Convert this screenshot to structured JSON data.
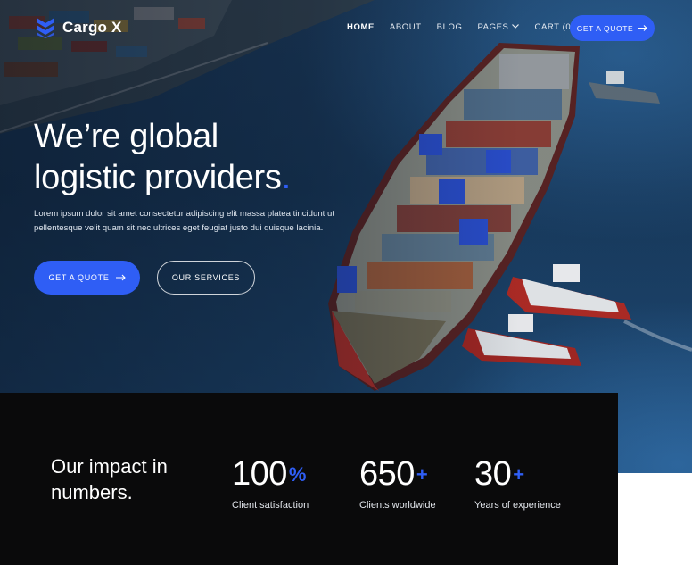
{
  "brand": {
    "name": "Cargo X",
    "logo_icon": "layered-chevron-logo",
    "accent": "#2f5ef5"
  },
  "nav": {
    "items": [
      {
        "label": "HOME",
        "active": true
      },
      {
        "label": "ABOUT"
      },
      {
        "label": "BLOG"
      },
      {
        "label": "PAGES",
        "icon": "chevron-down-icon"
      },
      {
        "label": "CART (0)"
      }
    ],
    "cta_label": "GET A QUOTE",
    "cta_icon": "arrow-right-icon"
  },
  "hero": {
    "headline_line1": "We’re global",
    "headline_line2": "logistic providers",
    "headline_dot": ".",
    "description": "Lorem ipsum dolor sit amet consectetur adipiscing elit massa platea tincidunt ut pellentesque velit quam sit nec ultrices eget feugiat justo dui quisque lacinia.",
    "primary_button": "GET A QUOTE",
    "secondary_button": "OUR SERVICES"
  },
  "stats": {
    "title": "Our impact in numbers.",
    "items": [
      {
        "value": "100",
        "suffix": "%",
        "label": "Client satisfaction"
      },
      {
        "value": "650",
        "suffix": "+",
        "label": "Clients worldwide"
      },
      {
        "value": "30",
        "suffix": "+",
        "label": "Years of experience"
      }
    ]
  }
}
